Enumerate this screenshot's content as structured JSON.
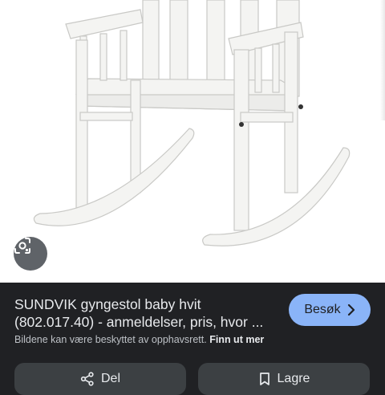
{
  "image": {
    "alt": "",
    "lens_icon": "lens-icon"
  },
  "result": {
    "title_line1": "SUNDVIK gyngestol baby hvit",
    "title_line2": "(802.017.40) - anmeldelser, pris, hvor ...",
    "visit_label": "Besøk",
    "copyright_text": "Bildene kan være beskyttet av opphavsrett.",
    "learn_more": "Finn ut mer"
  },
  "actions": {
    "share_label": "Del",
    "save_label": "Lagre"
  },
  "colors": {
    "background": "#202124",
    "accent": "#8ab4f8",
    "button": "#3c4043"
  }
}
